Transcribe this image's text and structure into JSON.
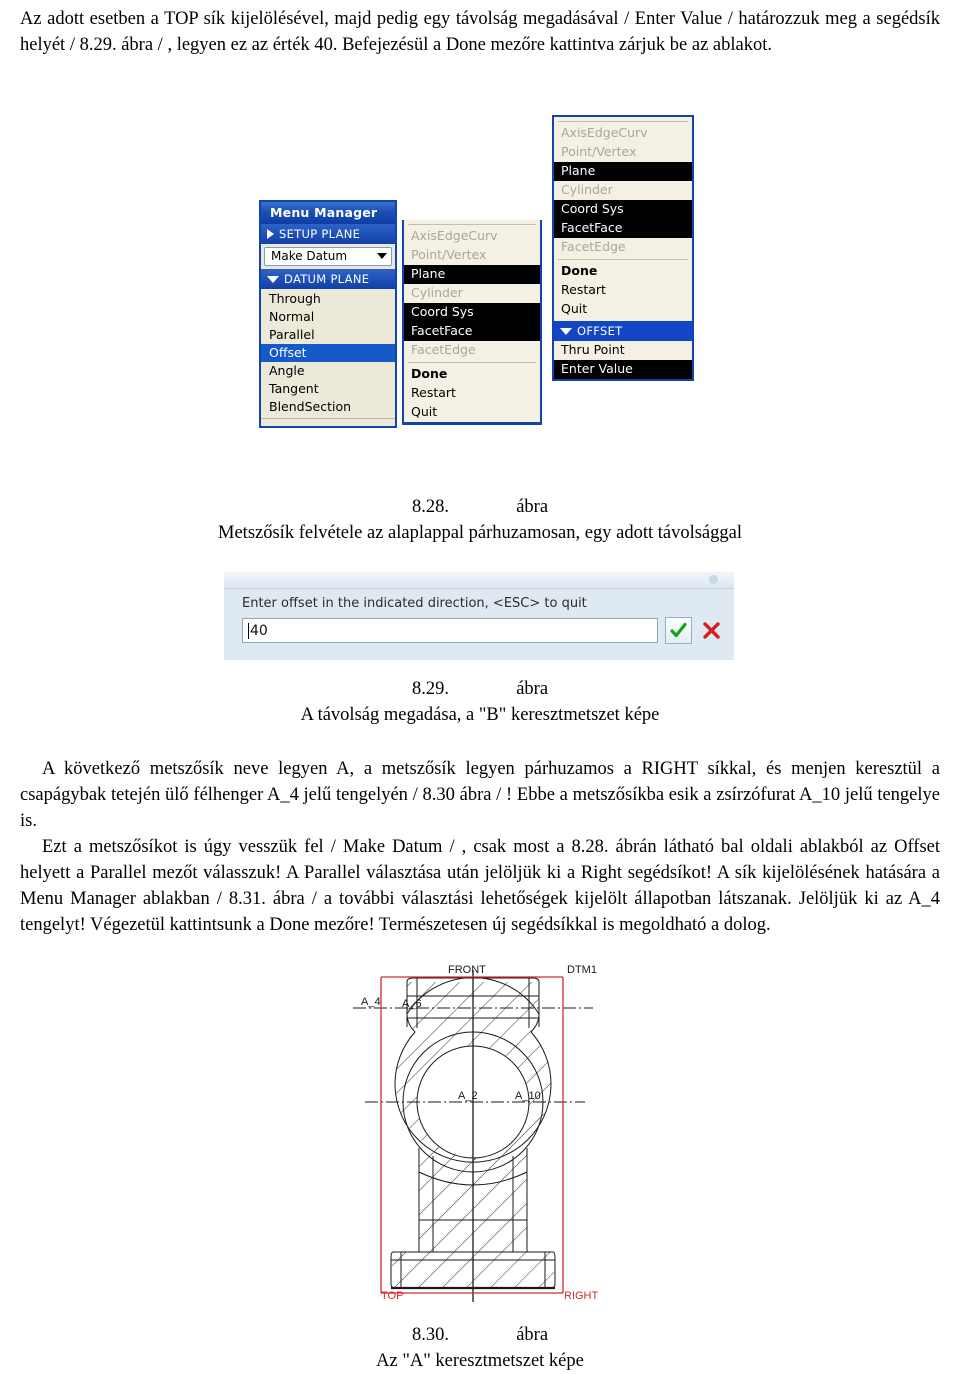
{
  "intro_paragraph": "Az adott esetben a TOP sík kijelölésével, majd pedig egy távolság megadásával / Enter Value / határozzuk meg a segédsík helyét / 8.29. ábra / , legyen ez az érték 40. Befejezésül a Done mezőre kattintva zárjuk be az ablakot.",
  "menu_manager": {
    "title": "Menu Manager",
    "setup_section": "SETUP PLANE",
    "combo_value": "Make Datum",
    "datum_section": "DATUM PLANE",
    "items": [
      {
        "label": "Through",
        "state": "normal"
      },
      {
        "label": "Normal",
        "state": "normal"
      },
      {
        "label": "Parallel",
        "state": "normal"
      },
      {
        "label": "Offset",
        "state": "selected"
      },
      {
        "label": "Angle",
        "state": "normal"
      },
      {
        "label": "Tangent",
        "state": "normal"
      },
      {
        "label": "BlendSection",
        "state": "normal"
      }
    ]
  },
  "menu_column_middle": {
    "items": [
      {
        "label": "AxisEdgeCurv",
        "state": "disabled"
      },
      {
        "label": "Point/Vertex",
        "state": "disabled"
      },
      {
        "label": "Plane",
        "state": "highlighted"
      },
      {
        "label": "Cylinder",
        "state": "disabled"
      },
      {
        "label": "Coord Sys",
        "state": "highlighted"
      },
      {
        "label": "FacetFace",
        "state": "highlighted"
      },
      {
        "label": "FacetEdge",
        "state": "disabled"
      },
      {
        "label": "Done",
        "state": "bold"
      },
      {
        "label": "Restart",
        "state": "normal"
      },
      {
        "label": "Quit",
        "state": "normal"
      }
    ]
  },
  "menu_column_right": {
    "items": [
      {
        "label": "AxisEdgeCurv",
        "state": "disabled"
      },
      {
        "label": "Point/Vertex",
        "state": "disabled"
      },
      {
        "label": "Plane",
        "state": "highlighted"
      },
      {
        "label": "Cylinder",
        "state": "disabled"
      },
      {
        "label": "Coord Sys",
        "state": "highlighted"
      },
      {
        "label": "FacetFace",
        "state": "highlighted"
      },
      {
        "label": "FacetEdge",
        "state": "disabled"
      },
      {
        "label": "Done",
        "state": "bold"
      },
      {
        "label": "Restart",
        "state": "normal"
      },
      {
        "label": "Quit",
        "state": "normal"
      }
    ],
    "offset_section": "OFFSET",
    "offset_items": [
      {
        "label": "Thru Point",
        "state": "normal"
      },
      {
        "label": "Enter Value",
        "state": "highlighted"
      }
    ]
  },
  "figure_828": {
    "number": "8.28.",
    "word": "ábra",
    "caption": "Metszősík felvétele az alaplappal párhuzamosan, egy adott távolsággal"
  },
  "offset_dialog": {
    "prompt": "Enter offset in the indicated direction, <ESC> to quit",
    "value": "40",
    "accept_icon": "check-icon",
    "cancel_icon": "x-icon"
  },
  "figure_829": {
    "number": "8.29.",
    "word": "ábra",
    "caption": "A távolság megadása, a \"B\" keresztmetszet képe"
  },
  "body_paragraph_1": "A következő metszősík neve legyen A, a metszősík legyen párhuzamos a RIGHT síkkal, és menjen keresztül a csapágybak tetején ülő félhenger A_4 jelű tengelyén / 8.30 ábra / ! Ebbe a metszősíkba esik a zsírzófurat A_10 jelű tengelye is.",
  "body_paragraph_2": "Ezt a metszősíkot is úgy vesszük fel / Make Datum / , csak most a 8.28. ábrán látható bal oldali ablakból az Offset helyett a Parallel mezőt válasszuk!  A Parallel választása után jelöljük ki a Right segédsíkot! A sík kijelölésének hatására a Menu Manager ablakban / 8.31. ábra / a további választási lehetőségek kijelölt állapotban látszanak. Jelöljük ki az A_4 tengelyt! Végezetül kattintsunk a Done mezőre! Természetesen új segédsíkkal is megoldható a dolog.",
  "drawing": {
    "labels": {
      "front": "FRONT",
      "dtm1": "DTM1",
      "a4": "A_4",
      "a6": "A_6",
      "a2": "A_2",
      "a10": "A_10",
      "top": "TOP",
      "right": "RIGHT"
    },
    "frame_color": "#d42a2a",
    "line_color": "#1a1a1a"
  },
  "figure_830": {
    "number": "8.30.",
    "word": "ábra",
    "caption": "Az \"A\" keresztmetszet képe"
  }
}
